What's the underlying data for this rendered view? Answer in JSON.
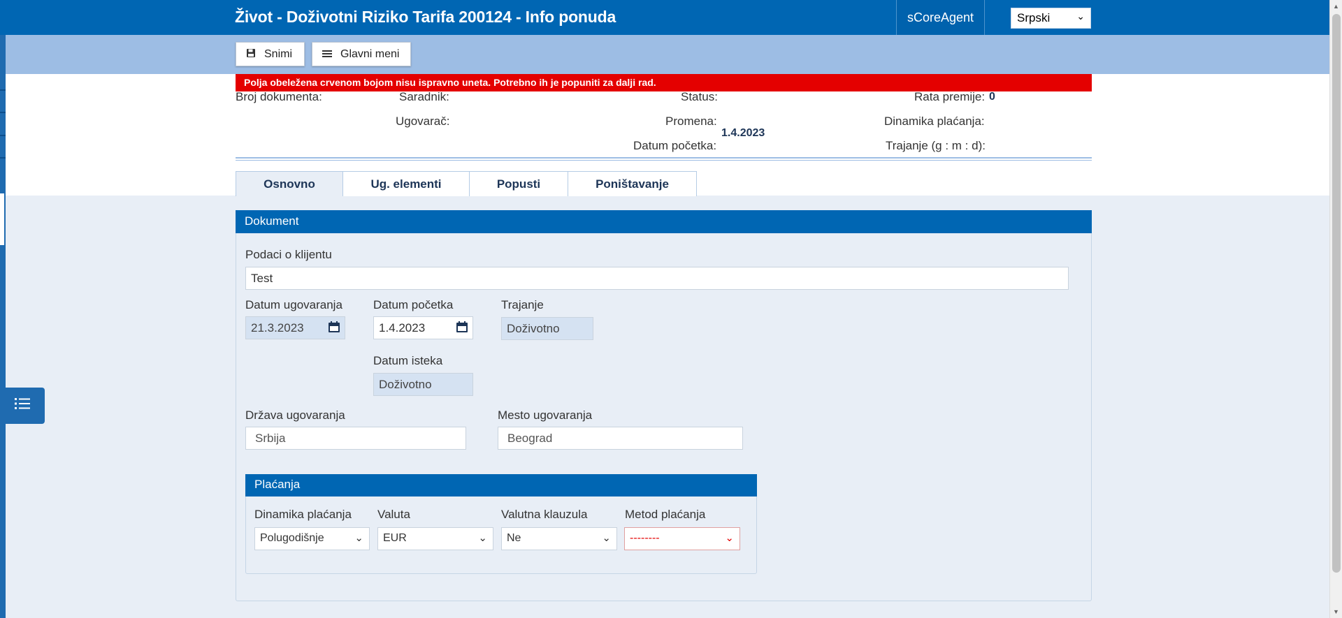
{
  "header": {
    "title": "Život - Doživotni Riziko Tarifa 200124 - Info ponuda",
    "agent": "sCoreAgent",
    "language": "Srpski"
  },
  "toolbar": {
    "save_label": "Snimi",
    "main_menu_label": "Glavni meni"
  },
  "error_message": "Polja obeležena crvenom bojom nisu ispravno uneta. Potrebno ih je popuniti za dalji rad.",
  "info": {
    "broj_dokumenta": "Broj dokumenta:",
    "saradnik": "Saradnik:",
    "ugovarac": "Ugovarač:",
    "status": "Status:",
    "promena": "Promena:",
    "datum_pocetka": "Datum početka:",
    "datum_pocetka_value": "1.4.2023",
    "rata_premije": "Rata premije:",
    "rata_premije_value": "0",
    "dinamika_placanja": "Dinamika plaćanja:",
    "trajanje": "Trajanje (g : m : d):"
  },
  "tabs": [
    "Osnovno",
    "Ug. elementi",
    "Popusti",
    "Poništavanje"
  ],
  "document": {
    "heading": "Dokument",
    "client_label": "Podaci o klijentu",
    "client_value": "Test",
    "contract_date_label": "Datum ugovaranja",
    "contract_date_value": "21.3.2023",
    "start_date_label": "Datum početka",
    "start_date_value": "1.4.2023",
    "duration_label": "Trajanje",
    "duration_value": "Doživotno",
    "expiry_label": "Datum isteka",
    "expiry_value": "Doživotno",
    "country_label": "Država ugovaranja",
    "country_value": "Srbija",
    "place_label": "Mesto ugovaranja",
    "place_value": "Beograd"
  },
  "payments": {
    "heading": "Plaćanja",
    "dynamics_label": "Dinamika plaćanja",
    "dynamics_value": "Polugodišnje",
    "currency_label": "Valuta",
    "currency_value": "EUR",
    "clause_label": "Valutna klauzula",
    "clause_value": "Ne",
    "method_label": "Metod plaćanja",
    "method_value": "--------"
  },
  "colors": {
    "brand": "#0066b3",
    "toolbar": "#9dbde4",
    "error": "#e40000"
  }
}
